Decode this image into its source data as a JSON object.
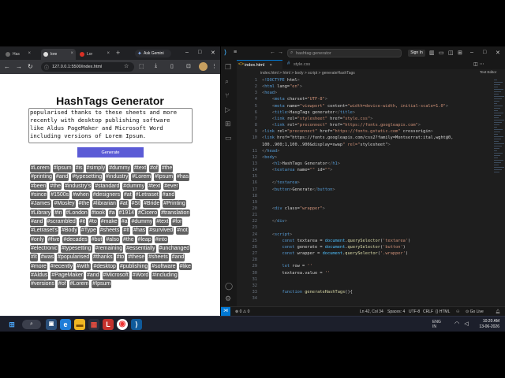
{
  "browser": {
    "tabs": [
      {
        "label": "Has"
      },
      {
        "label": "lore"
      },
      {
        "label": "Lor"
      }
    ],
    "gemini_label": "Ask Gemini",
    "url": "127.0.0.1:5500/index.html"
  },
  "page": {
    "title": "HashTags Generator",
    "textarea_text": "popularised thanks to these sheets and more\nrecently with desktop publishing software\nlike Aldus PageMaker and Microsoft Word\nincluding versions of Lorem Ipsum.",
    "generate_label": "Generate",
    "hashtags": [
      "#Lorem",
      "#Ipsum",
      "#is",
      "#simply",
      "#dummy",
      "#text",
      "#of",
      "#the",
      "#printing",
      "#and",
      "#typesetting",
      "#industry",
      "#Lorem",
      "#Ipsum",
      "#has",
      "#been",
      "#the",
      "#industry's",
      "#standard",
      "#dummy",
      "#text",
      "#ever",
      "#since",
      "#1500s",
      "#when",
      "#designers",
      "#at",
      "#Letraset",
      "#and",
      "#James",
      "#Mosley",
      "#the",
      "#librarian",
      "#at",
      "#St",
      "#Bride",
      "#Printing",
      "#Library",
      "#in",
      "#London",
      "#took",
      "#a",
      "#1914",
      "#Cicero",
      "#translation",
      "#and",
      "#scrambled",
      "#it",
      "#to",
      "#make",
      "#a",
      "#dummy",
      "#text",
      "#for",
      "#Letraset's",
      "#Body",
      "#Type",
      "#sheets",
      "#It",
      "#has",
      "#survived",
      "#not",
      "#only",
      "#five",
      "#decades",
      "#but",
      "#also",
      "#the",
      "#leap",
      "#into",
      "#electronic",
      "#typesetting",
      "#remaining",
      "#essentially",
      "#unchanged",
      "#It",
      "#was",
      "#popularised",
      "#thanks",
      "#to",
      "#these",
      "#sheets",
      "#and",
      "#more",
      "#recently",
      "#with",
      "#desktop",
      "#publishing",
      "#software",
      "#like",
      "#Aldus",
      "#PageMaker",
      "#and",
      "#Microsoft",
      "#Word",
      "#including",
      "#versions",
      "#of",
      "#Lorem",
      "#Ipsum"
    ]
  },
  "vscode": {
    "menu_icon": "hamburger-icon",
    "search_text": "hashtag generator",
    "signin_label": "Sign In",
    "tabs": [
      {
        "label": "index.html",
        "icon": "html-file-icon"
      },
      {
        "label": "style.css",
        "icon": "css-file-icon"
      }
    ],
    "breadcrumb": "index.html > html > body > script > generateHashTags",
    "text_editor_label": "Text Editor",
    "code_lines": [
      {
        "n": "1",
        "t": "<!DOCTYPE html>"
      },
      {
        "n": "2",
        "t": "<html lang=\"en\">"
      },
      {
        "n": "3",
        "t": "<head>"
      },
      {
        "n": "4",
        "t": "    <meta charset=\"UTF-8\">"
      },
      {
        "n": "5",
        "t": "    <meta name=\"viewport\" content=\"width=device-width, initial-scale=1.0\">"
      },
      {
        "n": "6",
        "t": "    <title>HasgTags generator</title>"
      },
      {
        "n": "7",
        "t": "    <link rel=\"stylesheet\" href=\"style.css\">"
      },
      {
        "n": "8",
        "t": "    <link rel=\"preconnect\" href=\"https://fonts.googleapis.com\">"
      },
      {
        "n": "9",
        "t": "<link rel=\"preconnect\" href=\"https://fonts.gstatic.com\" crossorigin>"
      },
      {
        "n": "10",
        "t": "<link href=\"https://fonts.googleapis.com/css2?family=Montserrat:ital,wght@0,"
      },
      {
        "n": "",
        "t": "100..900;1,100..900&display=swap\" rel=\"stylesheet\">"
      },
      {
        "n": "11",
        "t": "</head>"
      },
      {
        "n": "12",
        "t": "<body>"
      },
      {
        "n": "13",
        "t": "    <h1>HashTags Generator</h1>"
      },
      {
        "n": "14",
        "t": "    <textarea name=\"\" id=\"\">"
      },
      {
        "n": "15",
        "t": ""
      },
      {
        "n": "16",
        "t": "    </textarea>"
      },
      {
        "n": "17",
        "t": "    <button>Generate</button>"
      },
      {
        "n": "18",
        "t": ""
      },
      {
        "n": "19",
        "t": ""
      },
      {
        "n": "20",
        "t": "    <div class=\"wrapper\">"
      },
      {
        "n": "21",
        "t": ""
      },
      {
        "n": "22",
        "t": "    </div>"
      },
      {
        "n": "23",
        "t": ""
      },
      {
        "n": "24",
        "t": "    <script>"
      },
      {
        "n": "25",
        "t": "        const textarea = document.querySelector('textarea')"
      },
      {
        "n": "26",
        "t": "        const generate = document.querySelector('button')"
      },
      {
        "n": "27",
        "t": "        const wrapper = document.querySelector('.wrapper')"
      },
      {
        "n": "28",
        "t": ""
      },
      {
        "n": "29",
        "t": "        let row = ''"
      },
      {
        "n": "30",
        "t": "        textarea.value = ''"
      },
      {
        "n": "31",
        "t": ""
      },
      {
        "n": "32",
        "t": ""
      },
      {
        "n": "33",
        "t": "        function generateHashTags(){"
      },
      {
        "n": "34",
        "t": ""
      }
    ],
    "status": {
      "errors": "0",
      "warnings": "0",
      "position": "Ln 42, Col 34",
      "spaces": "Spaces: 4",
      "encoding": "UTF-8",
      "eol": "CRLF",
      "language": "HTML",
      "golive": "Go Live"
    }
  },
  "taskbar": {
    "lang": "ENG",
    "region": "IN",
    "time": "10:20 AM",
    "date": "13-06-2026"
  }
}
